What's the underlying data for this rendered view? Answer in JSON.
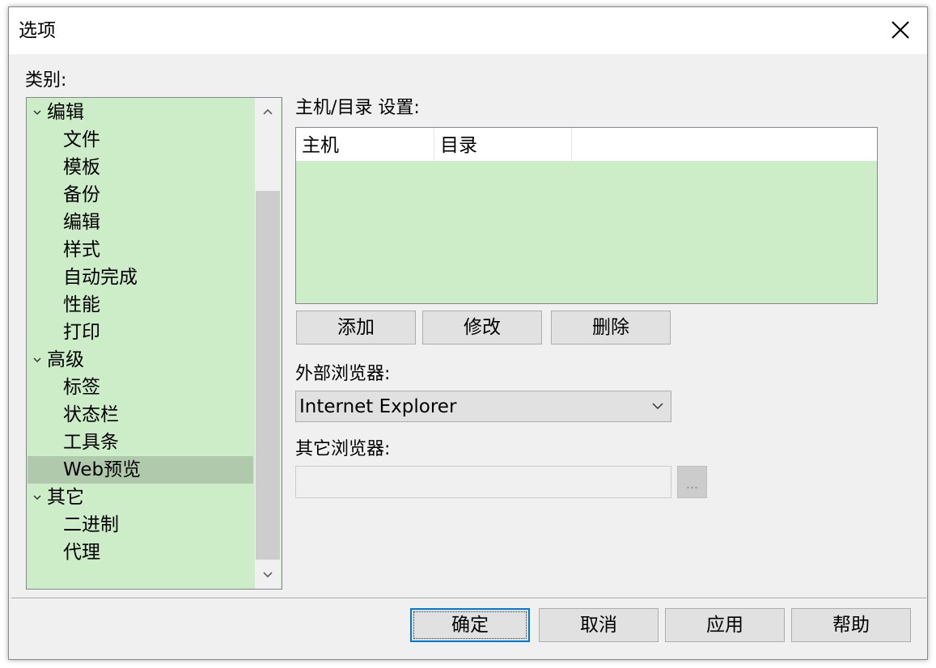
{
  "window": {
    "title": "选项",
    "close_icon": "close-icon"
  },
  "category": {
    "label": "类别:",
    "items": [
      {
        "label": "编辑",
        "level": 0,
        "expanded": true
      },
      {
        "label": "文件",
        "level": 1
      },
      {
        "label": "模板",
        "level": 1
      },
      {
        "label": "备份",
        "level": 1
      },
      {
        "label": "编辑",
        "level": 1
      },
      {
        "label": "样式",
        "level": 1
      },
      {
        "label": "自动完成",
        "level": 1
      },
      {
        "label": "性能",
        "level": 1
      },
      {
        "label": "打印",
        "level": 1
      },
      {
        "label": "高级",
        "level": 0,
        "expanded": true
      },
      {
        "label": "标签",
        "level": 1
      },
      {
        "label": "状态栏",
        "level": 1
      },
      {
        "label": "工具条",
        "level": 1
      },
      {
        "label": "Web预览",
        "level": 1,
        "selected": true
      },
      {
        "label": "其它",
        "level": 0,
        "expanded": true
      },
      {
        "label": "二进制",
        "level": 1
      },
      {
        "label": "代理",
        "level": 1
      }
    ]
  },
  "host_settings": {
    "label": "主机/目录 设置:",
    "columns": [
      "主机",
      "目录"
    ],
    "rows": [],
    "add_label": "添加",
    "edit_label": "修改",
    "delete_label": "删除"
  },
  "external_browser": {
    "label": "外部浏览器:",
    "selected": "Internet Explorer"
  },
  "other_browser": {
    "label": "其它浏览器:",
    "value": "",
    "browse_label": "..."
  },
  "footer": {
    "ok_label": "确定",
    "cancel_label": "取消",
    "apply_label": "应用",
    "help_label": "帮助"
  },
  "colors": {
    "tree_bg": "#cdedc9",
    "selected_bg": "#b0c9ad",
    "accent": "#0078d7"
  }
}
